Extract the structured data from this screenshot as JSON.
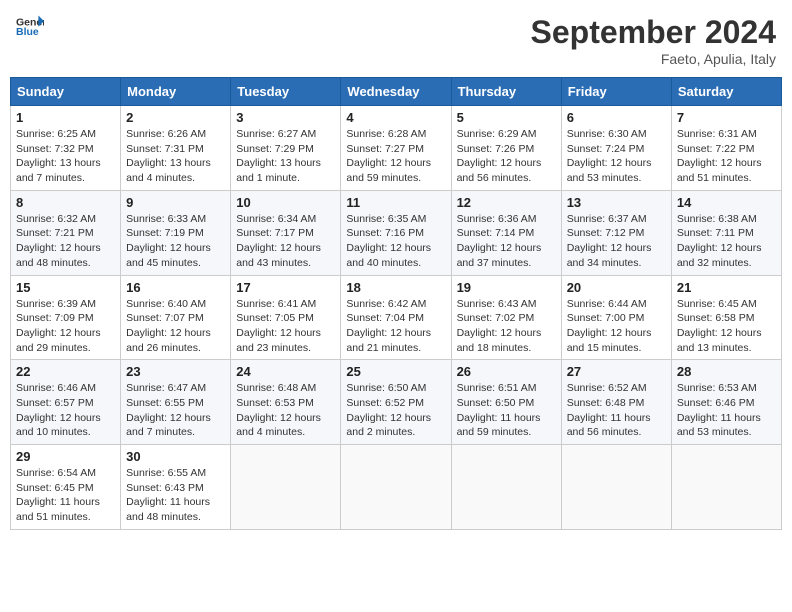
{
  "header": {
    "logo_general": "General",
    "logo_blue": "Blue",
    "month_title": "September 2024",
    "subtitle": "Faeto, Apulia, Italy"
  },
  "days_of_week": [
    "Sunday",
    "Monday",
    "Tuesday",
    "Wednesday",
    "Thursday",
    "Friday",
    "Saturday"
  ],
  "weeks": [
    [
      {
        "day": "1",
        "sunrise": "6:25 AM",
        "sunset": "7:32 PM",
        "daylight": "13 hours and 7 minutes."
      },
      {
        "day": "2",
        "sunrise": "6:26 AM",
        "sunset": "7:31 PM",
        "daylight": "13 hours and 4 minutes."
      },
      {
        "day": "3",
        "sunrise": "6:27 AM",
        "sunset": "7:29 PM",
        "daylight": "13 hours and 1 minute."
      },
      {
        "day": "4",
        "sunrise": "6:28 AM",
        "sunset": "7:27 PM",
        "daylight": "12 hours and 59 minutes."
      },
      {
        "day": "5",
        "sunrise": "6:29 AM",
        "sunset": "7:26 PM",
        "daylight": "12 hours and 56 minutes."
      },
      {
        "day": "6",
        "sunrise": "6:30 AM",
        "sunset": "7:24 PM",
        "daylight": "12 hours and 53 minutes."
      },
      {
        "day": "7",
        "sunrise": "6:31 AM",
        "sunset": "7:22 PM",
        "daylight": "12 hours and 51 minutes."
      }
    ],
    [
      {
        "day": "8",
        "sunrise": "6:32 AM",
        "sunset": "7:21 PM",
        "daylight": "12 hours and 48 minutes."
      },
      {
        "day": "9",
        "sunrise": "6:33 AM",
        "sunset": "7:19 PM",
        "daylight": "12 hours and 45 minutes."
      },
      {
        "day": "10",
        "sunrise": "6:34 AM",
        "sunset": "7:17 PM",
        "daylight": "12 hours and 43 minutes."
      },
      {
        "day": "11",
        "sunrise": "6:35 AM",
        "sunset": "7:16 PM",
        "daylight": "12 hours and 40 minutes."
      },
      {
        "day": "12",
        "sunrise": "6:36 AM",
        "sunset": "7:14 PM",
        "daylight": "12 hours and 37 minutes."
      },
      {
        "day": "13",
        "sunrise": "6:37 AM",
        "sunset": "7:12 PM",
        "daylight": "12 hours and 34 minutes."
      },
      {
        "day": "14",
        "sunrise": "6:38 AM",
        "sunset": "7:11 PM",
        "daylight": "12 hours and 32 minutes."
      }
    ],
    [
      {
        "day": "15",
        "sunrise": "6:39 AM",
        "sunset": "7:09 PM",
        "daylight": "12 hours and 29 minutes."
      },
      {
        "day": "16",
        "sunrise": "6:40 AM",
        "sunset": "7:07 PM",
        "daylight": "12 hours and 26 minutes."
      },
      {
        "day": "17",
        "sunrise": "6:41 AM",
        "sunset": "7:05 PM",
        "daylight": "12 hours and 23 minutes."
      },
      {
        "day": "18",
        "sunrise": "6:42 AM",
        "sunset": "7:04 PM",
        "daylight": "12 hours and 21 minutes."
      },
      {
        "day": "19",
        "sunrise": "6:43 AM",
        "sunset": "7:02 PM",
        "daylight": "12 hours and 18 minutes."
      },
      {
        "day": "20",
        "sunrise": "6:44 AM",
        "sunset": "7:00 PM",
        "daylight": "12 hours and 15 minutes."
      },
      {
        "day": "21",
        "sunrise": "6:45 AM",
        "sunset": "6:58 PM",
        "daylight": "12 hours and 13 minutes."
      }
    ],
    [
      {
        "day": "22",
        "sunrise": "6:46 AM",
        "sunset": "6:57 PM",
        "daylight": "12 hours and 10 minutes."
      },
      {
        "day": "23",
        "sunrise": "6:47 AM",
        "sunset": "6:55 PM",
        "daylight": "12 hours and 7 minutes."
      },
      {
        "day": "24",
        "sunrise": "6:48 AM",
        "sunset": "6:53 PM",
        "daylight": "12 hours and 4 minutes."
      },
      {
        "day": "25",
        "sunrise": "6:50 AM",
        "sunset": "6:52 PM",
        "daylight": "12 hours and 2 minutes."
      },
      {
        "day": "26",
        "sunrise": "6:51 AM",
        "sunset": "6:50 PM",
        "daylight": "11 hours and 59 minutes."
      },
      {
        "day": "27",
        "sunrise": "6:52 AM",
        "sunset": "6:48 PM",
        "daylight": "11 hours and 56 minutes."
      },
      {
        "day": "28",
        "sunrise": "6:53 AM",
        "sunset": "6:46 PM",
        "daylight": "11 hours and 53 minutes."
      }
    ],
    [
      {
        "day": "29",
        "sunrise": "6:54 AM",
        "sunset": "6:45 PM",
        "daylight": "11 hours and 51 minutes."
      },
      {
        "day": "30",
        "sunrise": "6:55 AM",
        "sunset": "6:43 PM",
        "daylight": "11 hours and 48 minutes."
      },
      null,
      null,
      null,
      null,
      null
    ]
  ]
}
